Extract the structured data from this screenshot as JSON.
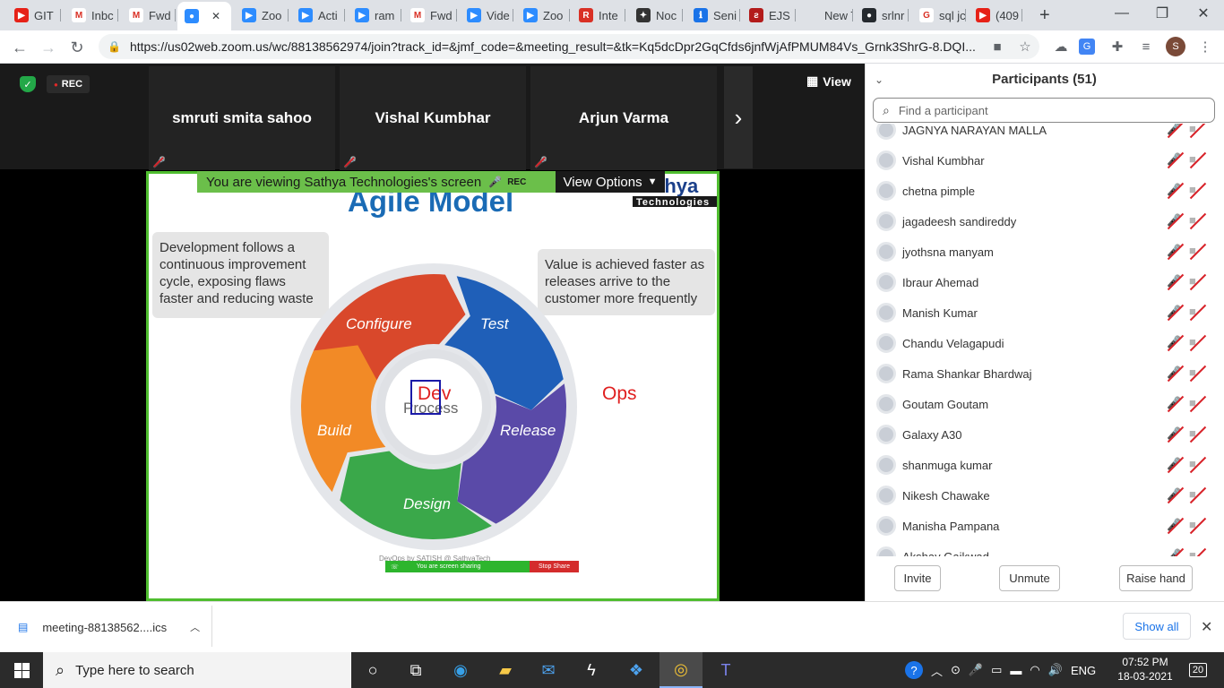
{
  "browser": {
    "tabs": [
      {
        "label": "GIT",
        "fav_color": "#e62117",
        "fav_char": "▶"
      },
      {
        "label": "Inbc",
        "fav_color": "#ffffff",
        "fav_char": "M"
      },
      {
        "label": "Fwd",
        "fav_color": "#ffffff",
        "fav_char": "M"
      },
      {
        "label": "",
        "fav_color": "#2d8cff",
        "fav_char": "●"
      },
      {
        "label": "Zoo",
        "fav_color": "#2d8cff",
        "fav_char": "▶"
      },
      {
        "label": "Acti",
        "fav_color": "#2d8cff",
        "fav_char": "▶"
      },
      {
        "label": "ram",
        "fav_color": "#2d8cff",
        "fav_char": "▶"
      },
      {
        "label": "Fwd",
        "fav_color": "#ffffff",
        "fav_char": "M"
      },
      {
        "label": "Vide",
        "fav_color": "#2d8cff",
        "fav_char": "▶"
      },
      {
        "label": "Zoo",
        "fav_color": "#2d8cff",
        "fav_char": "▶"
      },
      {
        "label": "Inte",
        "fav_color": "#d93025",
        "fav_char": "R"
      },
      {
        "label": "Noc",
        "fav_color": "#333333",
        "fav_char": "✦"
      },
      {
        "label": "Seni",
        "fav_color": "#1a73e8",
        "fav_char": "ℹ"
      },
      {
        "label": "EJS",
        "fav_color": "#b31b1b",
        "fav_char": "ƨ"
      },
      {
        "label": "New Tab",
        "fav_color": "#dee1e6",
        "fav_char": ""
      },
      {
        "label": "srlnr",
        "fav_color": "#24292e",
        "fav_char": "●"
      },
      {
        "label": "sql jc",
        "fav_color": "#ffffff",
        "fav_char": "G"
      },
      {
        "label": "(409",
        "fav_color": "#e62117",
        "fav_char": "▶"
      }
    ],
    "new_tab": "+",
    "url": "https://us02web.zoom.us/wc/88138562974/join?track_id=&jmf_code=&meeting_result=&tk=Kq5dcDpr2GqCfds6jnfWjAfPMUM84Vs_Grnk3ShrG-8.DQI...",
    "profile_initial": "S"
  },
  "zoom": {
    "rec_label": "REC",
    "view_label": "View",
    "gallery": [
      "smruti smita sahoo",
      "Vishal Kumbhar",
      "Arjun Varma"
    ],
    "share_banner": "You are viewing Sathya Technologies's screen",
    "share_rec": "REC",
    "view_options": "View Options",
    "slide": {
      "title": "Agile Model",
      "logo_top": "thya",
      "logo_bottom": "Technologies",
      "callout_left": "Development follows a continuous improvement cycle, exposing flaws faster and reducing waste",
      "callout_right": "Value is achieved faster as releases arrive to the customer more frequently",
      "segments": [
        "Configure",
        "Test",
        "Release",
        "Design",
        "Build"
      ],
      "center": "Process",
      "dev": "Dev",
      "ops": "Ops",
      "footnote": "DevOps by SATISH @ SathyaTech",
      "sharing_text": "You are screen sharing",
      "stop_share": "Stop Share"
    }
  },
  "participants": {
    "title": "Participants (51)",
    "search_placeholder": "Find a participant",
    "list": [
      "JAGNYA NARAYAN MALLA",
      "Vishal Kumbhar",
      "chetna pimple",
      "jagadeesh sandireddy",
      "jyothsna manyam",
      "Ibraur Ahemad",
      "Manish Kumar",
      "Chandu Velagapudi",
      "Rama Shankar Bhardwaj",
      "Goutam Goutam",
      "Galaxy A30",
      "shanmuga kumar",
      "Nikesh Chawake",
      "Manisha Pampana",
      "Akshay Gaikwad"
    ],
    "buttons": {
      "invite": "Invite",
      "unmute": "Unmute",
      "raise_hand": "Raise hand"
    }
  },
  "download": {
    "file": "meeting-88138562....ics",
    "show_all": "Show all"
  },
  "taskbar": {
    "search_placeholder": "Type here to search",
    "lang": "ENG",
    "time": "07:52 PM",
    "date": "18-03-2021",
    "notifications": "20"
  },
  "colors": {
    "share_border": "#4fbd2f",
    "configure": "#d9482b",
    "test": "#1f5fb8",
    "release": "#5a4aa8",
    "design": "#3aa84a",
    "build": "#f28a26"
  }
}
